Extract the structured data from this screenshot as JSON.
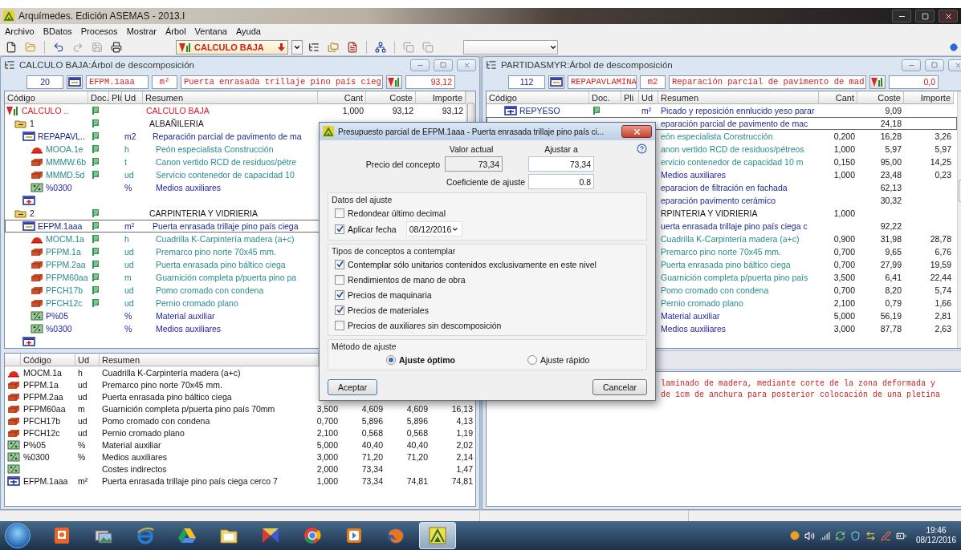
{
  "window": {
    "title": "Arquímedes. Edición ASEMAS - 2013.I"
  },
  "menu": [
    "Archivo",
    "BDatos",
    "Procesos",
    "Mostrar",
    "Árbol",
    "Ventana",
    "Ayuda"
  ],
  "toolbar": {
    "combo": "CALCULO BAJA"
  },
  "left_panel": {
    "title": "CALCULO BAJA:Árbol de descomposición",
    "fields": {
      "number": "20",
      "code": "EFPM.1aaa",
      "unit": "m²",
      "summary": "Puerta enrasada trillaje pino país cieg",
      "amount": "93,12"
    },
    "columns": [
      "Código",
      "Doc.",
      "Pli",
      "Ud",
      "Resumen",
      "Cant",
      "Coste",
      "Importe"
    ],
    "tree": [
      {
        "kind": "root",
        "code": "CALCULO ..",
        "doc": true,
        "summary": "CALCULO BAJA",
        "cant": "1,000",
        "coste": "93,12",
        "importe": "93,12",
        "selected": false,
        "children": [
          {
            "kind": "chapter",
            "code": "1",
            "doc": true,
            "expanded": true,
            "summary": "ALBAÑILERIA",
            "selected": false,
            "children": [
              {
                "kind": "item",
                "code": "REPAPAVL..",
                "doc": true,
                "expanded": true,
                "unit": "m2",
                "summary": "Reparación parcial de pavimento de ma",
                "selected": false,
                "children": [
                  {
                    "kind": "labor",
                    "code": "MOOA.1e",
                    "doc": true,
                    "unit": "h",
                    "summary": "Peón especialista Construcción",
                    "selected": false
                  },
                  {
                    "kind": "material",
                    "code": "MMMW.6b",
                    "doc": true,
                    "unit": "t",
                    "summary": "Canon vertido RCD de residuos/pétre",
                    "selected": false
                  },
                  {
                    "kind": "material",
                    "code": "MMMD.5d",
                    "doc": true,
                    "unit": "ud",
                    "summary": "Servicio contenedor de capacidad 10",
                    "selected": false
                  },
                  {
                    "kind": "percent",
                    "code": "%0300",
                    "doc": false,
                    "unit": "%",
                    "summary": "Medios auxiliares",
                    "selected": false
                  }
                ]
              },
              {
                "kind": "add",
                "selected": false
              }
            ]
          },
          {
            "kind": "chapter",
            "code": "2",
            "doc": true,
            "expanded": true,
            "summary": "CARPINTERIA Y VIDRIERIA",
            "selected": false,
            "children": [
              {
                "kind": "item",
                "code": "EFPM.1aaa",
                "doc": true,
                "expanded": true,
                "unit": "m²",
                "summary": "Puerta enrasada trillaje pino país ciega",
                "selected": true,
                "children": [
                  {
                    "kind": "labor",
                    "code": "MOCM.1a",
                    "doc": true,
                    "unit": "h",
                    "summary": "Cuadrilla K-Carpintería madera (a+c)",
                    "selected": false
                  },
                  {
                    "kind": "material",
                    "code": "PFPM.1a",
                    "doc": true,
                    "unit": "ud",
                    "summary": "Premarco pino norte 70x45 mm.",
                    "selected": false
                  },
                  {
                    "kind": "material",
                    "code": "PFPM.2aa",
                    "doc": true,
                    "unit": "ud",
                    "summary": "Puerta enrasada pino báltico ciega",
                    "selected": false
                  },
                  {
                    "kind": "material",
                    "code": "PFPM60aa",
                    "doc": true,
                    "unit": "m",
                    "summary": "Guarnición completa p/puerta pino pa",
                    "selected": false
                  },
                  {
                    "kind": "material",
                    "code": "PFCH17b",
                    "doc": true,
                    "unit": "ud",
                    "summary": "Pomo cromado con condena",
                    "selected": false
                  },
                  {
                    "kind": "material",
                    "code": "PFCH12c",
                    "doc": true,
                    "unit": "ud",
                    "summary": "Pernio cromado plano",
                    "selected": false
                  },
                  {
                    "kind": "percent",
                    "code": "P%05",
                    "doc": false,
                    "unit": "%",
                    "summary": "Material auxiliar",
                    "selected": false
                  },
                  {
                    "kind": "percent",
                    "code": "%0300",
                    "doc": false,
                    "unit": "%",
                    "summary": "Medios auxiliares",
                    "selected": false
                  }
                ]
              },
              {
                "kind": "add",
                "selected": false
              }
            ]
          }
        ]
      }
    ],
    "bottom_table": {
      "columns": [
        "Código",
        "Ud",
        "Resumen"
      ],
      "rows": [
        {
          "kind": "labor",
          "code": "MOCM.1a",
          "unit": "h",
          "summary": "Cuadrilla K-Carpintería madera (a+c)"
        },
        {
          "kind": "material",
          "code": "PFPM.1a",
          "unit": "ud",
          "summary": "Premarco pino norte 70x45 mm."
        },
        {
          "kind": "material",
          "code": "PFPM.2aa",
          "unit": "ud",
          "summary": "Puerta enrasada pino báltico ciega"
        },
        {
          "kind": "material",
          "code": "PFPM60aa",
          "unit": "m",
          "summary": "Guarnición completa p/puerta pino país 70mm",
          "column_4": "3,500",
          "column_5": "4,609",
          "column_6": "4,609",
          "column_7": "16,13"
        },
        {
          "kind": "material",
          "code": "PFCH17b",
          "unit": "ud",
          "summary": "Pomo cromado con condena",
          "column_4": "0,700",
          "column_5": "5,896",
          "column_6": "5,896",
          "column_7": "4,13"
        },
        {
          "kind": "material",
          "code": "PFCH12c",
          "unit": "ud",
          "summary": "Pernio cromado plano",
          "column_4": "2,100",
          "column_5": "0,568",
          "column_6": "0,568",
          "column_7": "1,19"
        },
        {
          "kind": "percent",
          "code": "P%05",
          "unit": "%",
          "summary": "Material auxiliar",
          "column_4": "5,000",
          "column_5": "40,40",
          "column_6": "40,40",
          "column_7": "2,02"
        },
        {
          "kind": "percent",
          "code": "%0300",
          "unit": "%",
          "summary": "Medios auxiliares",
          "column_4": "3,000",
          "column_5": "71,20",
          "column_6": "71,20",
          "column_7": "2,14"
        },
        {
          "kind": "percent",
          "summary": "Costes indirectos",
          "column_4": "2,000",
          "column_5": "73,34",
          "column_7": "1,47"
        },
        {
          "kind": "item",
          "code": "EFPM.1aaa",
          "unit": "m²",
          "summary": "Puerta enrasada trillaje pino país ciega cerco 7",
          "column_4": "1,000",
          "column_5": "73,34",
          "column_6": "74,81",
          "column_7": "74,81"
        }
      ]
    }
  },
  "right_panel": {
    "title": "PARTIDASMYR:Árbol de descomposición",
    "fields": {
      "number": "112",
      "code": "REPAPAVLAMINA",
      "unit": "m2",
      "summary": "Reparación parcial de pavimento de mad",
      "amount": "0,0"
    },
    "columns": [
      "Código",
      "Doc.",
      "Pli",
      "Ud",
      "Resumen",
      "Cant",
      "Coste",
      "Importe"
    ],
    "rows": [
      {
        "kind": "item",
        "code": "REPYESO",
        "doc": true,
        "expanded": false,
        "unit": "m²",
        "summary": "Picado y reposición ennlucido yeso parar",
        "coste": "9,09",
        "selected": false
      },
      {
        "kind": "item",
        "summary": "eparación parcial de pavimento de mac",
        "coste": "24,18",
        "selected": true
      },
      {
        "kind": "labor",
        "summary": "eón especialista Construcción",
        "cant": "0,200",
        "coste": "16,28",
        "importe": "3,26",
        "selected": false
      },
      {
        "kind": "material",
        "summary": "anon vertido RCD de residuos/pétreos",
        "cant": "1,000",
        "coste": "5,97",
        "importe": "5,97",
        "selected": false
      },
      {
        "kind": "material",
        "summary": "ervicio contenedor de capacidad 10 m",
        "cant": "0,150",
        "coste": "95,00",
        "importe": "14,25",
        "selected": false
      },
      {
        "kind": "percent",
        "summary": "Medios auxiliares",
        "cant": "1,000",
        "coste": "23,48",
        "importe": "0,23",
        "selected": false
      },
      {
        "kind": "item",
        "summary": "eparacion de filtración en fachada",
        "coste": "62,13",
        "selected": false
      },
      {
        "kind": "item",
        "summary": "eparación pavimento cerámico",
        "coste": "30,32",
        "selected": false
      },
      {
        "kind": "chapter",
        "summary": "RPINTERIA Y VIDRIERIA",
        "cant": "1,000",
        "selected": false
      },
      {
        "kind": "item",
        "summary": "uerta enrasada trillaje pino país ciega c",
        "coste": "92,22",
        "selected": false
      },
      {
        "kind": "labor",
        "summary": "Cuadrilla K-Carpintería madera (a+c)",
        "cant": "0,900",
        "coste": "31,98",
        "importe": "28,78",
        "selected": false
      },
      {
        "kind": "material",
        "summary": "Premarco pino norte 70x45 mm.",
        "cant": "0,700",
        "coste": "9,65",
        "importe": "6,76",
        "selected": false
      },
      {
        "kind": "material",
        "summary": "Puerta enrasada pino báltico ciega",
        "cant": "0,700",
        "coste": "27,99",
        "importe": "19,59",
        "selected": false
      },
      {
        "kind": "material",
        "summary": "Guarnición completa p/puerta pino país",
        "cant": "3,500",
        "coste": "6,41",
        "importe": "22,44",
        "selected": false
      },
      {
        "kind": "material",
        "summary": "Pomo cromado con condena",
        "cant": "0,700",
        "coste": "8,20",
        "importe": "5,74",
        "selected": false
      },
      {
        "kind": "material",
        "summary": "Pernio cromado plano",
        "cant": "2,100",
        "coste": "0,79",
        "importe": "1,66",
        "selected": false
      },
      {
        "kind": "percent",
        "summary": "Material auxiliar",
        "cant": "5,000",
        "coste": "56,19",
        "importe": "2,81",
        "selected": false
      },
      {
        "kind": "percent",
        "summary": "Medios auxiliares",
        "cant": "3,000",
        "coste": "87,78",
        "importe": "2,63",
        "selected": false
      }
    ],
    "description_lines": [
      "laminado de madera, mediante corte de la zona deformada y",
      "de 1cm de anchura para posterior colocación de una pletina"
    ]
  },
  "dialog": {
    "title": "Presupuesto parcial de EFPM.1aaa - Puerta enrasada trillaje pino país ci...",
    "col_current": "Valor actual",
    "col_adjust": "Ajustar a",
    "price_label": "Precio del concepto",
    "price_current": "73,34",
    "price_adjust": "73,34",
    "coef_label": "Coeficiente de ajuste",
    "coef_value": "0.8",
    "groups": [
      {
        "title": "Datos del ajuste",
        "options": [
          {
            "kind": "checkbox",
            "label": "Redondear último decimal",
            "checked": false
          },
          {
            "kind": "date",
            "label": "Aplicar fecha",
            "checked": true,
            "value": "08/12/2016"
          }
        ]
      },
      {
        "title": "Tipos de conceptos a contemplar",
        "options": [
          {
            "kind": "checkbox",
            "label": "Contemplar sólo unitarios contenidos exclusivamente en este nivel",
            "checked": true
          },
          {
            "kind": "checkbox",
            "label": "Rendimientos de mano de obra",
            "checked": false
          },
          {
            "kind": "checkbox",
            "label": "Precios de maquinaria",
            "checked": true
          },
          {
            "kind": "checkbox",
            "label": "Precios de materiales",
            "checked": true
          },
          {
            "kind": "checkbox",
            "label": "Precios de auxiliares sin descomposición",
            "checked": false
          }
        ]
      },
      {
        "title": "Método de ajuste",
        "options": [
          {
            "kind": "radio",
            "label": "Ajuste óptimo",
            "selected": true
          },
          {
            "kind": "radio",
            "label": "Ajuste rápido",
            "selected": false
          }
        ]
      }
    ],
    "buttons": [
      "Aceptar",
      "Cancelar"
    ]
  },
  "taskbar": {
    "apps": [
      {
        "kind": "slides",
        "active": false
      },
      {
        "kind": "photos",
        "active": false
      },
      {
        "kind": "browser",
        "active": false
      },
      {
        "kind": "drive",
        "active": false
      },
      {
        "kind": "folder",
        "active": false
      },
      {
        "kind": "tool",
        "active": false
      },
      {
        "kind": "wheel",
        "active": false
      },
      {
        "kind": "media",
        "active": false
      },
      {
        "kind": "fox",
        "active": false
      },
      {
        "kind": "arquimedes",
        "active": true
      }
    ],
    "time": "19:46",
    "date": "08/12/2016"
  }
}
